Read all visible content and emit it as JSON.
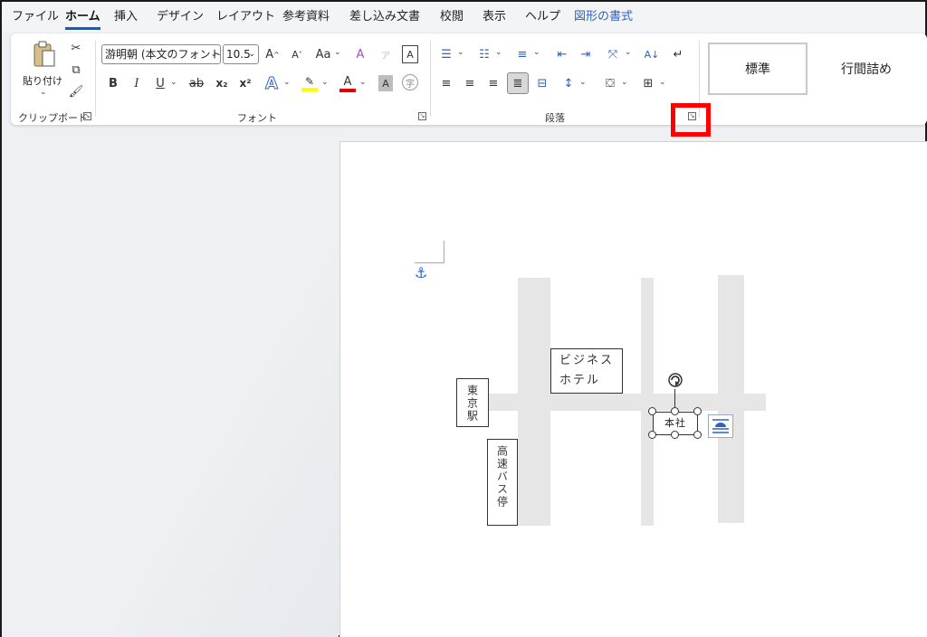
{
  "tabs": [
    {
      "label": "ファイル",
      "active": false,
      "contextual": false
    },
    {
      "label": "ホーム",
      "active": true,
      "contextual": false
    },
    {
      "label": "挿入",
      "active": false,
      "contextual": false
    },
    {
      "label": "デザイン",
      "active": false,
      "contextual": false
    },
    {
      "label": "レイアウト",
      "active": false,
      "contextual": false
    },
    {
      "label": "参考資料",
      "active": false,
      "contextual": false
    },
    {
      "label": "差し込み文書",
      "active": false,
      "contextual": false
    },
    {
      "label": "校閲",
      "active": false,
      "contextual": false
    },
    {
      "label": "表示",
      "active": false,
      "contextual": false
    },
    {
      "label": "ヘルプ",
      "active": false,
      "contextual": false
    },
    {
      "label": "図形の書式",
      "active": false,
      "contextual": true
    }
  ],
  "clipboard": {
    "paste_label": "貼り付け",
    "group_label": "クリップボード"
  },
  "font": {
    "name": "游明朝 (本文のフォント",
    "size": "10.5",
    "group_label": "フォント",
    "grow": "A^",
    "shrink": "A˅",
    "case": "Aa",
    "clear": "A",
    "bold": "B",
    "italic": "I",
    "underline": "U",
    "strike": "ab",
    "subscript": "x₂",
    "superscript": "x²",
    "font_color_letter": "A",
    "highlight_color": "#ffff00",
    "font_color": "#e00000"
  },
  "paragraph": {
    "group_label": "段落"
  },
  "styles": {
    "items": [
      "標準",
      "行間詰め"
    ]
  },
  "document": {
    "hotel_line1": "ビジネス",
    "hotel_line2": "ホテル",
    "station": "東京駅",
    "busstop": "高速バス停",
    "honsha": "本社"
  },
  "colors": {
    "accent": "#2b579a",
    "highlight_frame": "#ff0000",
    "contextual_tab": "#2b62c5"
  }
}
